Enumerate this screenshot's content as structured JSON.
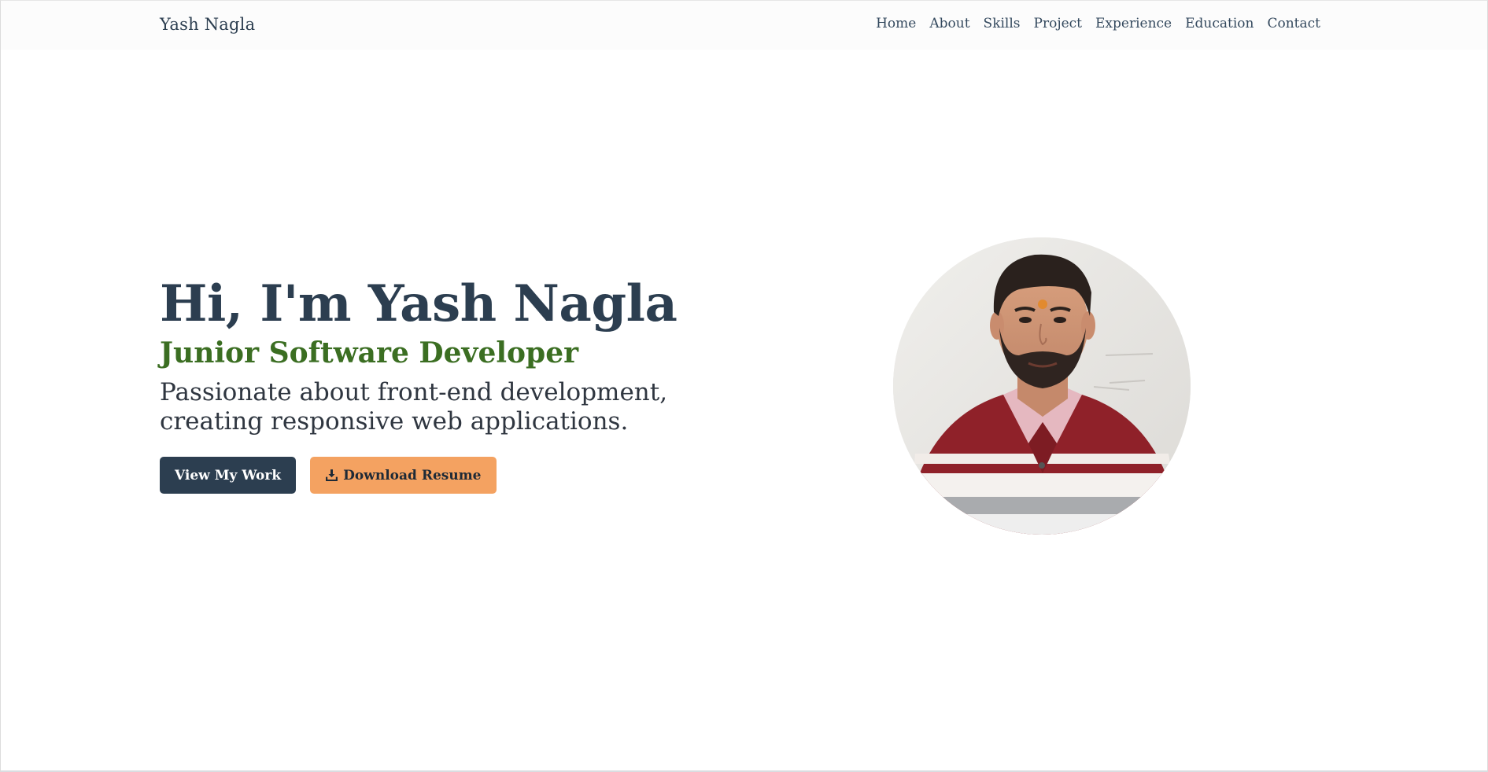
{
  "navbar": {
    "brand": "Yash Nagla",
    "links": [
      "Home",
      "About",
      "Skills",
      "Project",
      "Experience",
      "Education",
      "Contact"
    ]
  },
  "hero": {
    "title": "Hi, I'm Yash Nagla",
    "subtitle": "Junior Software Developer",
    "description": "Passionate about front-end development, creating responsive web applications.",
    "primary_button": "View My Work",
    "secondary_button": "Download Resume",
    "secondary_button_icon": "download-icon"
  },
  "colors": {
    "dark": "#2c3e50",
    "green": "#3b6e22",
    "accent": "#f4a261"
  }
}
